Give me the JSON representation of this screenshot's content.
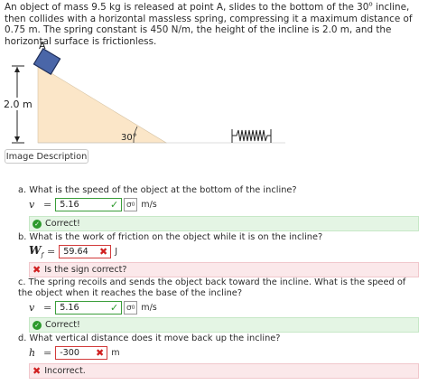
{
  "problem": {
    "text_before_deg": "An object of mass 9.5 kg is released at point A, slides to the bottom of the 30",
    "deg": "o",
    "text_after_deg": " incline, then collides with a horizontal massless spring, compressing it a maximum distance of 0.75 m. The spring constant is 450 N/m, the height of the incline is 2.0 m, and the horizontal surface is frictionless."
  },
  "figure": {
    "point_label": "A",
    "height_label": "2.0 m",
    "angle_label": "30°",
    "incline_color": "#fbe6c8",
    "block_color": "#4a66a8"
  },
  "image_description_button": "Image Description",
  "questions": [
    {
      "label": "a. What is the speed of the object at the bottom of the incline?",
      "variable": "v",
      "equals": "=",
      "value": "5.16",
      "status": "correct",
      "unit": "m/s",
      "feedback": "Correct!"
    },
    {
      "label": "b. What is the work of friction on the object while it is on the incline?",
      "variable": "W",
      "variable_sub": "f",
      "equals": "=",
      "value": "59.64",
      "status": "incorrect",
      "unit": "J",
      "feedback": "Is the sign correct?"
    },
    {
      "label": "c. The spring recoils and sends the object back toward the incline. What is the speed of the object when it reaches the base of the incline?",
      "variable": "v",
      "equals": "=",
      "value": "5.16",
      "status": "correct",
      "unit": "m/s",
      "feedback": "Correct!"
    },
    {
      "label": "d. What vertical distance does it move back up the incline?",
      "variable": "h",
      "equals": "=",
      "value": "-300",
      "status": "incorrect",
      "unit": "m",
      "feedback": "Incorrect."
    }
  ],
  "icons": {
    "check": "✓",
    "cross": "✖",
    "unit_tool": "σ⁰"
  }
}
